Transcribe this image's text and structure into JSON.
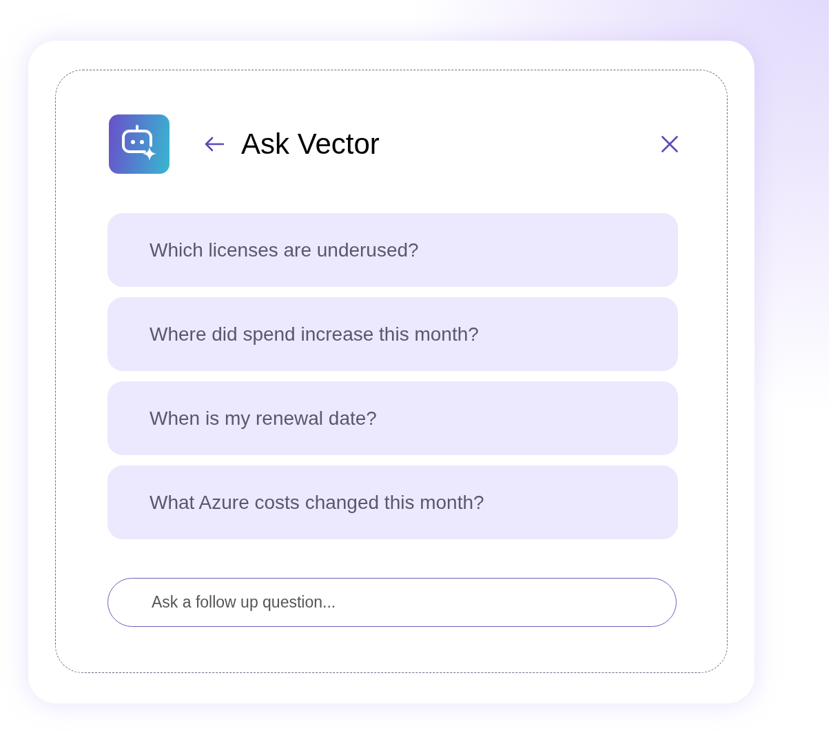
{
  "header": {
    "title": "Ask Vector"
  },
  "suggestions": [
    "Which licenses are underused?",
    "Where did spend increase this month?",
    "When is my renewal date?",
    "What Azure costs changed this month?"
  ],
  "input": {
    "placeholder": "Ask a follow up question..."
  }
}
